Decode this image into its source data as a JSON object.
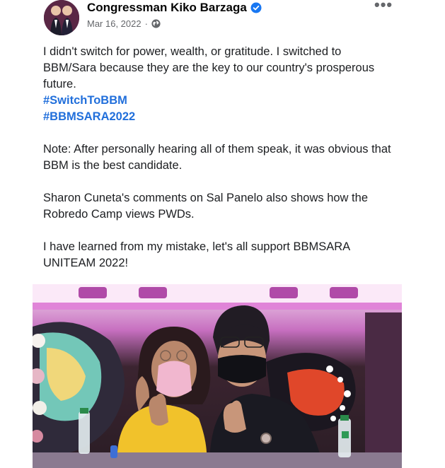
{
  "post": {
    "author": "Congressman Kiko Barzaga",
    "date": "Mar 16, 2022",
    "separator": "·",
    "more_label": "•••",
    "icons": {
      "verified": "verified-badge-icon",
      "privacy": "globe-icon",
      "more": "more-options-icon"
    },
    "colors": {
      "hashtag": "#216fdb",
      "verified": "#1877f2",
      "meta": "#65676b"
    },
    "paragraphs": [
      "I didn't switch for power, wealth, or gratitude. I switched to BBM/Sara because they are the key to our country's prosperous future.",
      "Note: After personally hearing all of them speak, it was obvious that BBM is the best candidate.",
      "Sharon Cuneta's comments on Sal Panelo also shows how the Robredo Camp views PWDs.",
      "I have learned from my mistake, let's all support BBMSARA UNITEAM 2022!"
    ],
    "hashtags": [
      "#SwitchToBBM",
      "#BBMSARA2022"
    ]
  }
}
